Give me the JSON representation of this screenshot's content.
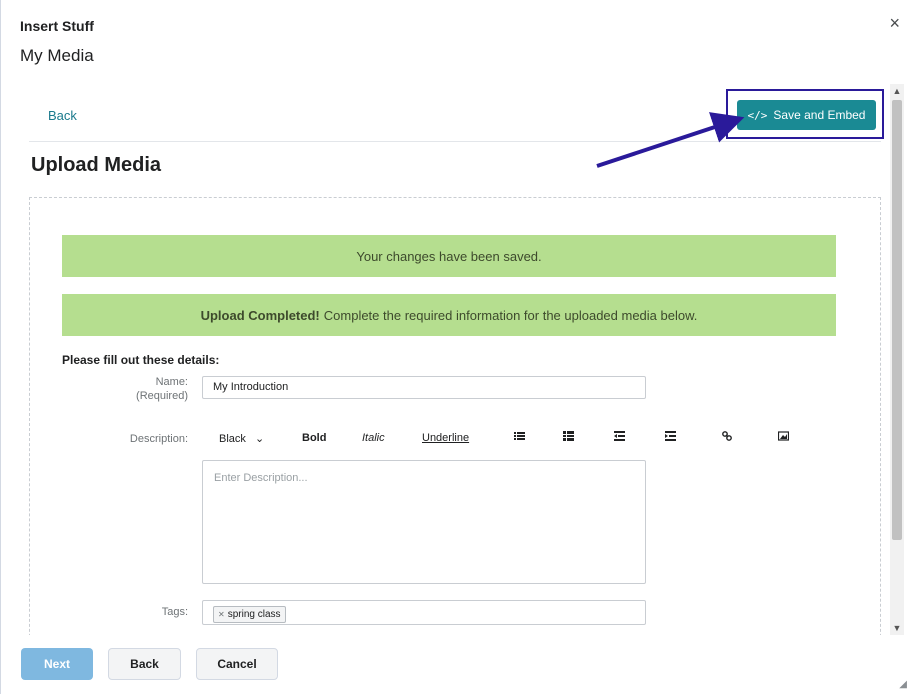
{
  "dialog": {
    "title": "Insert Stuff",
    "subtitle": "My Media",
    "close_icon": "×"
  },
  "top": {
    "back_label": "Back",
    "save_embed_label": "Save and Embed",
    "save_embed_icon": "</>"
  },
  "upload": {
    "title": "Upload Media",
    "msg_saved": "Your changes have been saved.",
    "msg_completed_strong": "Upload Completed!",
    "msg_completed_rest": "Complete the required information for the uploaded media below.",
    "details_title": "Please fill out these details:"
  },
  "form": {
    "name_label": "Name:",
    "name_required": "(Required)",
    "name_value": "My Introduction",
    "description_label": "Description:",
    "description_placeholder": "Enter Description...",
    "tags_label": "Tags:",
    "tags": [
      "spring class"
    ]
  },
  "toolbar": {
    "color_label": "Black",
    "color_chevron": "⌄",
    "bold": "Bold",
    "italic": "Italic",
    "underline": "Underline"
  },
  "footer": {
    "next_label": "Next",
    "back_label": "Back",
    "cancel_label": "Cancel"
  },
  "colors": {
    "accent": "#1a8a94",
    "success_bg": "#b5de8f",
    "annotation": "#2a1a9a"
  }
}
